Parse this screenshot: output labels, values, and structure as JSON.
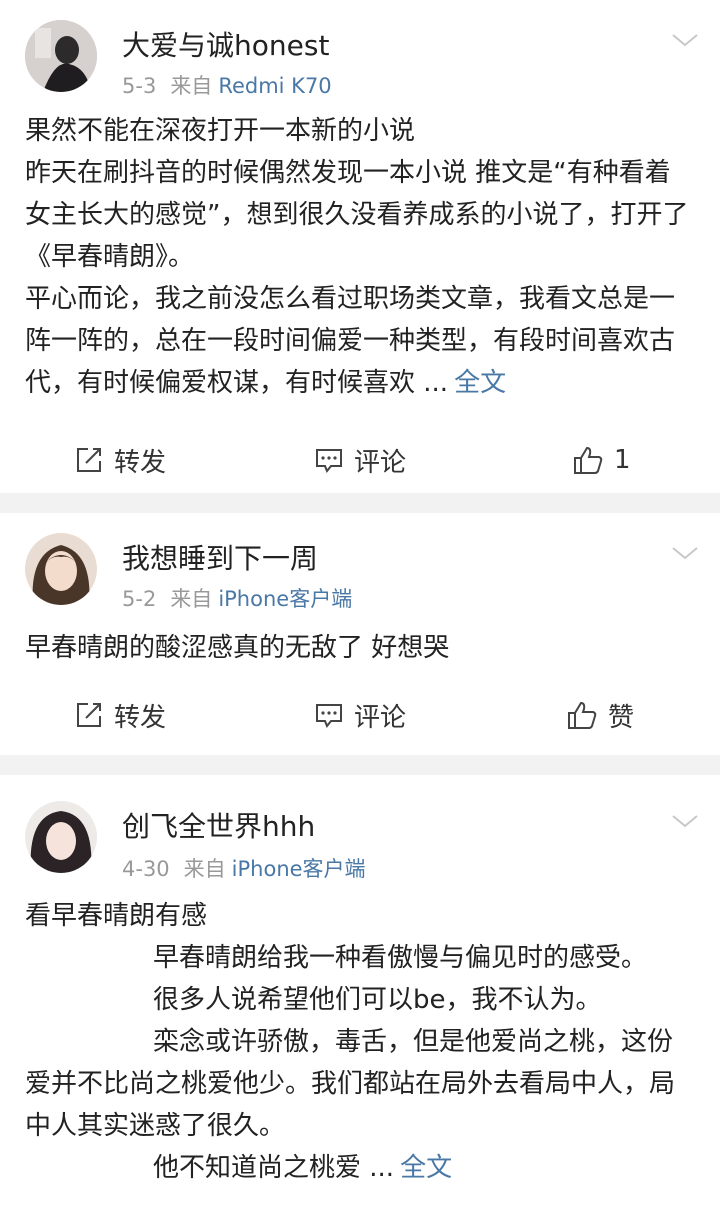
{
  "posts": [
    {
      "username": "大爱与诚honest",
      "date": "5-3",
      "from_prefix": "来自",
      "source": "Redmi K70",
      "paragraphs": [
        "果然不能在深夜打开一本新的小说",
        "昨天在刷抖音的时候偶然发现一本小说 推文是“有种看着女主长大的感觉”，想到很久没看养成系的小说了，打开了《早春晴朗》。",
        "平心而论，我之前没怎么看过职场类文章，我看文总是一阵一阵的，总在一段时间偏爱一种类型，有段时间喜欢古代，有时候偏爱权谋，有时候喜欢 ..."
      ],
      "full_text_label": "全文",
      "repost_label": "转发",
      "comment_label": "评论",
      "like_label": "1"
    },
    {
      "username": "我想睡到下一周",
      "date": "5-2",
      "from_prefix": "来自",
      "source": "iPhone客户端",
      "paragraphs": [
        "早春晴朗的酸涩感真的无敌了 好想哭"
      ],
      "repost_label": "转发",
      "comment_label": "评论",
      "like_label": "赞"
    },
    {
      "username": "创飞全世界hhh",
      "date": "4-30",
      "from_prefix": "来自",
      "source": "iPhone客户端",
      "paragraphs": [
        "看早春晴朗有感",
        "早春晴朗给我一种看傲慢与偏见时的感受。",
        "很多人说希望他们可以be，我不认为。",
        "栾念或许骄傲，毒舌，但是他爱尚之桃，这份爱并不比尚之桃爱他少。我们都站在局外去看局中人，局中人其实迷惑了很久。",
        "他不知道尚之桃爱 ..."
      ],
      "full_text_label": "全文"
    }
  ],
  "colors": {
    "link": "#4a78a6",
    "meta": "#999999",
    "separator": "#f2f2f2"
  }
}
